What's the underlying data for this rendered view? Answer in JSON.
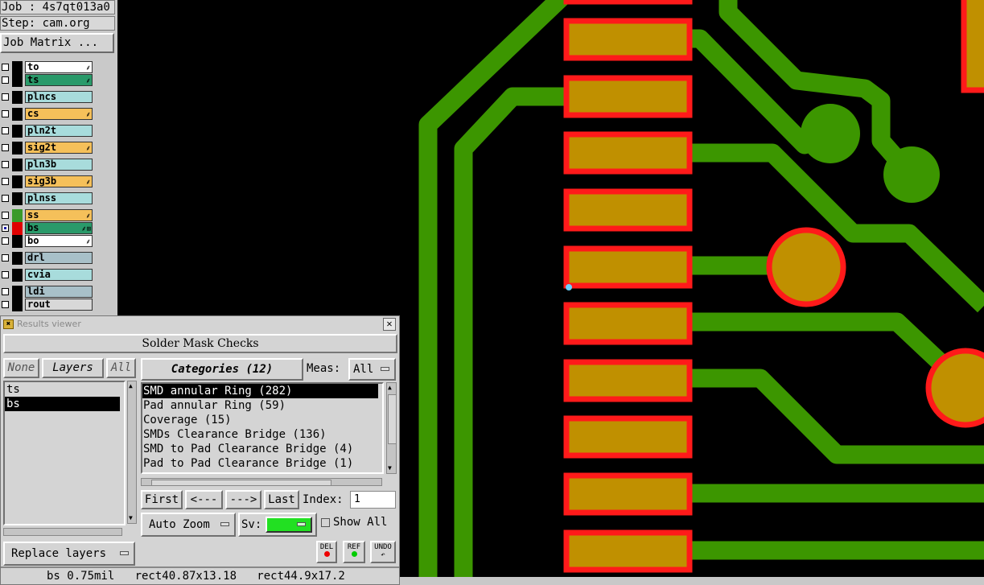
{
  "job": {
    "label": "Job : 4s7qt013a0",
    "step": "Step: cam.org",
    "matrix_button": "Job Matrix ..."
  },
  "layers": [
    {
      "name": "to",
      "color": "#ffffff",
      "checked": false,
      "swatch": "#000000",
      "mark": "⸙"
    },
    {
      "name": "ts",
      "color": "#2a9a6a",
      "checked": false,
      "swatch": "#000000",
      "mark": "⸙"
    },
    {
      "name": "plncs",
      "color": "#a8dcdc",
      "checked": false,
      "swatch": "#000000",
      "mark": ""
    },
    {
      "name": "cs",
      "color": "#f5c05a",
      "checked": false,
      "swatch": "#000000",
      "mark": "⸙"
    },
    {
      "name": "pln2t",
      "color": "#a8dcdc",
      "checked": false,
      "swatch": "#000000",
      "mark": ""
    },
    {
      "name": "sig2t",
      "color": "#f5c05a",
      "checked": false,
      "swatch": "#000000",
      "mark": "⸙"
    },
    {
      "name": "pln3b",
      "color": "#a8dcdc",
      "checked": false,
      "swatch": "#000000",
      "mark": ""
    },
    {
      "name": "sig3b",
      "color": "#f5c05a",
      "checked": false,
      "swatch": "#000000",
      "mark": "⸙"
    },
    {
      "name": "plnss",
      "color": "#a8dcdc",
      "checked": false,
      "swatch": "#000000",
      "mark": ""
    },
    {
      "name": "ss",
      "color": "#f5c05a",
      "checked": false,
      "swatch": "#3a9a2a",
      "mark": "⸙"
    },
    {
      "name": "bs",
      "color": "#2a9a6a",
      "checked": true,
      "swatch": "#e00000",
      "mark": "⸙⊞"
    },
    {
      "name": "bo",
      "color": "#ffffff",
      "checked": false,
      "swatch": "#000000",
      "mark": "⸙"
    },
    {
      "name": "drl",
      "color": "#a8c0c8",
      "checked": false,
      "swatch": "#000000",
      "mark": ""
    },
    {
      "name": "cvia",
      "color": "#a8dcdc",
      "checked": false,
      "swatch": "#000000",
      "mark": ""
    },
    {
      "name": "ldi",
      "color": "#a8c0c8",
      "checked": false,
      "swatch": "#000000",
      "mark": ""
    },
    {
      "name": "rout",
      "color": "#d8d8d8",
      "checked": false,
      "swatch": "#000000",
      "mark": ""
    }
  ],
  "results_viewer": {
    "title": "Results viewer",
    "close_glyph": "✕",
    "check_name": "Solder Mask Checks",
    "none_button": "None",
    "layers_button": "Layers",
    "all_button": "All",
    "layer_items": [
      "ts",
      "bs"
    ],
    "selected_layer": "bs",
    "categories_button": "Categories (12)",
    "meas_label": "Meas:",
    "meas_value": "All",
    "categories": [
      "SMD annular Ring (282)",
      "Pad annular Ring (59)",
      "Coverage (15)",
      "SMDs Clearance Bridge (136)",
      "SMD to Pad Clearance Bridge (4)",
      "Pad to Pad Clearance Bridge (1)"
    ],
    "selected_category": "SMD annular Ring (282)",
    "first_button": "First",
    "prev_button": "<---",
    "next_button": "--->",
    "last_button": "Last",
    "index_label": "Index:",
    "index_value": "1",
    "auto_zoom": "Auto Zoom",
    "sv_label": "Sv:",
    "sv_color": "#22e022",
    "show_all_label": "Show All",
    "replace_layers": "Replace layers",
    "del_label": "DEL",
    "ref_label": "REF",
    "undo_label": "UNDO",
    "status": "bs 0.75mil   rect40.87x13.18   rect44.9x17.2"
  },
  "colors": {
    "trace": "#3c9600",
    "pad_fill": "#c09000",
    "pad_outline": "#ff1a1a",
    "background": "#000000"
  }
}
